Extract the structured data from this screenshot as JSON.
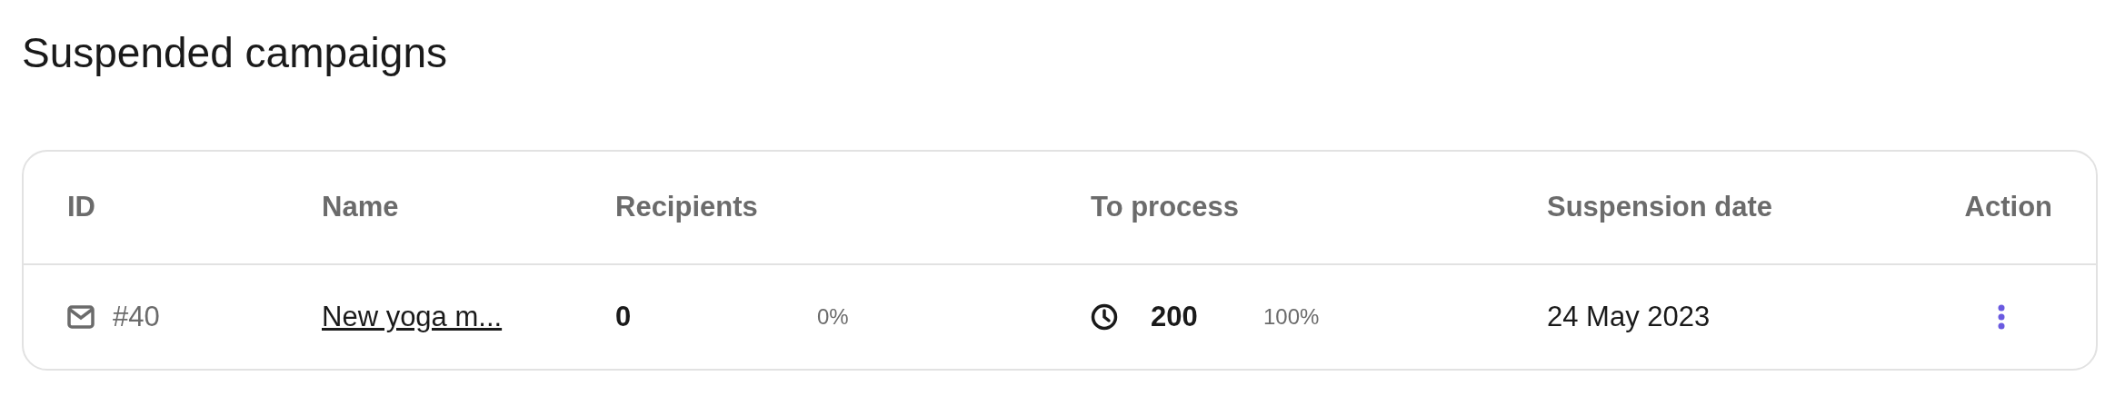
{
  "title": "Suspended campaigns",
  "table": {
    "columns": [
      "ID",
      "Name",
      "Recipients",
      "To process",
      "Suspension date",
      "Action"
    ],
    "rows": [
      {
        "id": "#40",
        "name": "New yoga m...",
        "recipients": "0",
        "recipients_percent": "0%",
        "to_process": "200",
        "to_process_percent": "100%",
        "suspension_date": "24 May 2023"
      }
    ]
  }
}
